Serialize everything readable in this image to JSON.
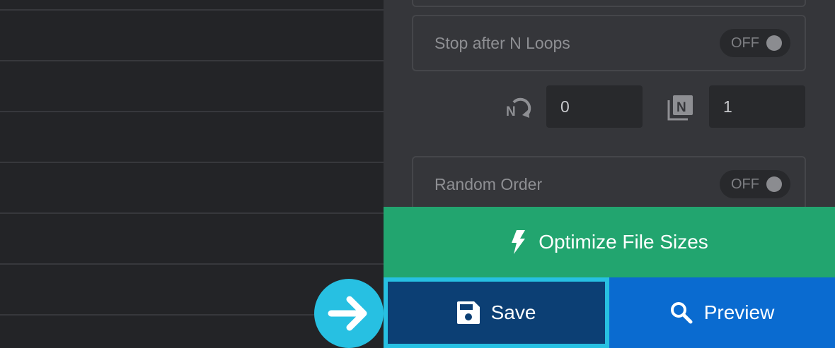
{
  "settings": {
    "stop_after_loops": {
      "label": "Stop after N Loops",
      "state": "OFF"
    },
    "loop_count_value": "0",
    "n_frames_value": "1",
    "random_order": {
      "label": "Random Order",
      "state": "OFF"
    }
  },
  "actions": {
    "optimize_label": "Optimize File Sizes",
    "save_label": "Save",
    "preview_label": "Preview"
  },
  "colors": {
    "optimize": "#22a56f",
    "save": "#0c3f74",
    "save_highlight": "#27c0e2",
    "preview": "#0a6bd0"
  },
  "icons": {
    "optimize": "lightning-bolt-icon",
    "save": "floppy-disk-icon",
    "preview": "magnifier-icon",
    "loop": "loop-n-icon",
    "frames": "stacked-n-icon",
    "pointer": "arrow-right-icon"
  }
}
